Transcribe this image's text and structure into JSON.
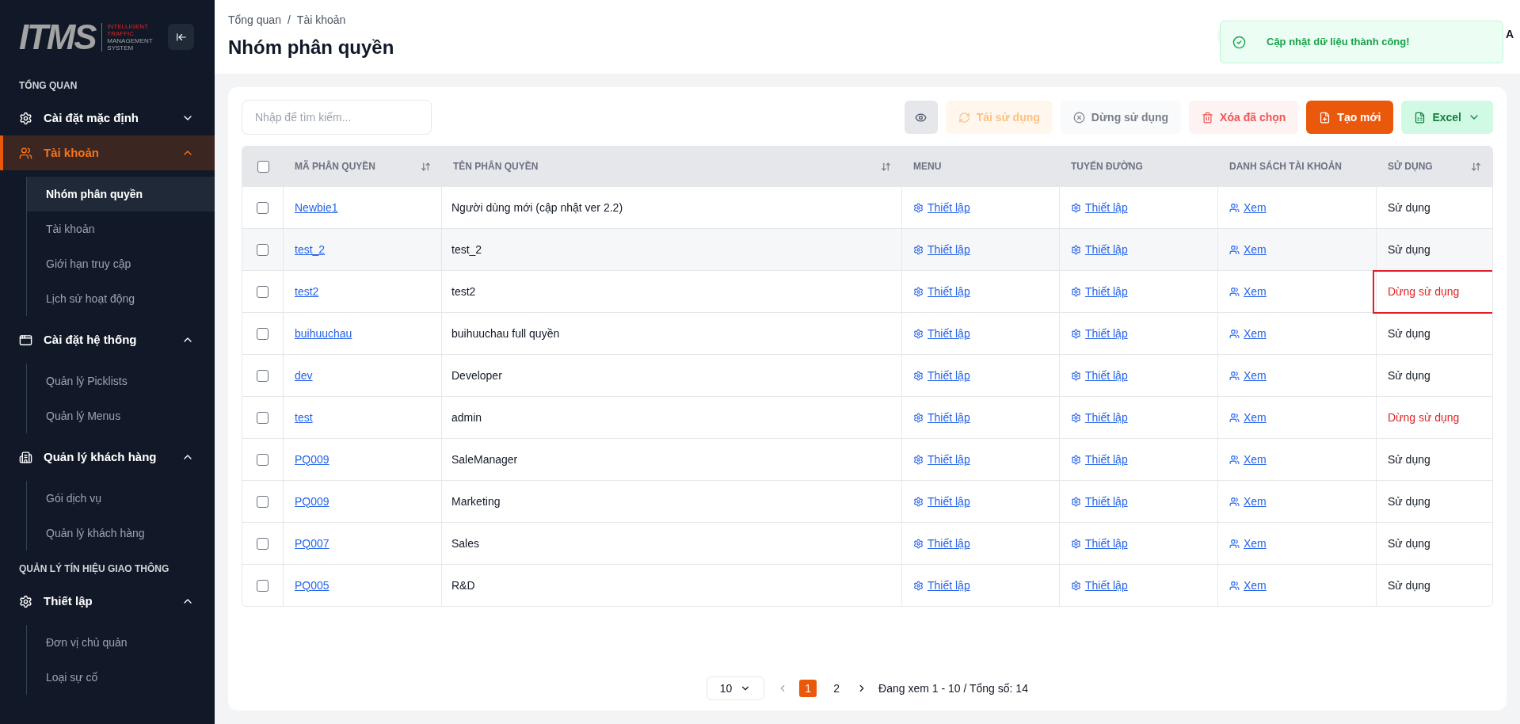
{
  "sidebar": {
    "logo": {
      "mark": "ITMS",
      "tagline_red": [
        "INTELLIGENT",
        "TRAFFIC"
      ],
      "tagline_grey": [
        "MANAGEMENT",
        "SYSTEM"
      ]
    },
    "sections": [
      {
        "heading": "TỔNG QUAN",
        "groups": [
          {
            "label": "Cài đặt mặc định",
            "expanded": false,
            "selected": false
          },
          {
            "label": "Tài khoản",
            "expanded": true,
            "selected": true,
            "children": [
              {
                "label": "Nhóm phân quyền",
                "selected": true
              },
              {
                "label": "Tài khoản",
                "selected": false
              },
              {
                "label": "Giới hạn truy cập",
                "selected": false
              },
              {
                "label": "Lịch sử hoạt động",
                "selected": false
              }
            ]
          },
          {
            "label": "Cài đặt hệ thống",
            "expanded": true,
            "selected": false,
            "children": [
              {
                "label": "Quản lý Picklists",
                "selected": false
              },
              {
                "label": "Quản lý Menus",
                "selected": false
              }
            ]
          },
          {
            "label": "Quản lý khách hàng",
            "expanded": true,
            "selected": false,
            "children": [
              {
                "label": "Gói dịch vụ",
                "selected": false
              },
              {
                "label": "Quản lý khách hàng",
                "selected": false
              }
            ]
          }
        ]
      },
      {
        "heading": "QUẢN LÝ TÍN HIỆU GIAO THÔNG",
        "groups": [
          {
            "label": "Thiết lập",
            "expanded": true,
            "selected": false,
            "children": [
              {
                "label": "Đơn vị chủ quản",
                "selected": false
              },
              {
                "label": "Loại sự cố",
                "selected": false
              }
            ]
          }
        ]
      }
    ]
  },
  "breadcrumb": {
    "items": [
      "Tổng quan",
      "Tài khoản"
    ],
    "separator": "/"
  },
  "page_title": "Nhóm phân quyền",
  "user_initial": "A",
  "toast": {
    "kind": "success",
    "message": "Cập nhật dữ liệu thành công!"
  },
  "search": {
    "placeholder": "Nhập để tìm kiếm..."
  },
  "toolbar": [
    {
      "kind": "view",
      "disabled": false
    },
    {
      "kind": "reuse",
      "label": "Tái sử dụng",
      "disabled": true
    },
    {
      "kind": "stop",
      "label": "Dừng sử dụng",
      "disabled": true
    },
    {
      "kind": "delete",
      "label": "Xóa đã chọn",
      "disabled": true
    },
    {
      "kind": "create",
      "label": "Tạo mới",
      "disabled": false
    },
    {
      "kind": "export",
      "label": "Excel",
      "disabled": false
    }
  ],
  "table": {
    "select_all": {
      "checked": false
    },
    "columns": [
      {
        "label": "MÃ PHÂN QUYỀN",
        "sortable": true
      },
      {
        "label": "TÊN PHÂN QUYỀN",
        "sortable": true
      },
      {
        "label": "MENU",
        "sortable": false
      },
      {
        "label": "TUYẾN ĐƯỜNG",
        "sortable": false
      },
      {
        "label": "DANH SÁCH TÀI KHOẢN",
        "sortable": false
      },
      {
        "label": "SỬ DỤNG",
        "sortable": true
      }
    ],
    "rows": [
      {
        "checked": false,
        "hovered": false,
        "code": "Newbie1",
        "name": "Người dùng mới (cập nhật ver 2.2)",
        "menu": "Thiết lập",
        "route": "Thiết lập",
        "accounts": "Xem",
        "status": "Sử dụng",
        "in_use": true,
        "highlighted": false
      },
      {
        "checked": false,
        "hovered": true,
        "code": "test_2",
        "name": "test_2",
        "menu": "Thiết lập",
        "route": "Thiết lập",
        "accounts": "Xem",
        "status": "Sử dụng",
        "in_use": true,
        "highlighted": false
      },
      {
        "checked": false,
        "hovered": false,
        "code": "test2",
        "name": "test2",
        "menu": "Thiết lập",
        "route": "Thiết lập",
        "accounts": "Xem",
        "status": "Dừng sử dụng",
        "in_use": false,
        "highlighted": true
      },
      {
        "checked": false,
        "hovered": false,
        "code": "buihuuchau",
        "name": "buihuuchau full quyền",
        "menu": "Thiết lập",
        "route": "Thiết lập",
        "accounts": "Xem",
        "status": "Sử dụng",
        "in_use": true,
        "highlighted": false
      },
      {
        "checked": false,
        "hovered": false,
        "code": "dev",
        "name": "Developer",
        "menu": "Thiết lập",
        "route": "Thiết lập",
        "accounts": "Xem",
        "status": "Sử dụng",
        "in_use": true,
        "highlighted": false
      },
      {
        "checked": false,
        "hovered": false,
        "code": "test",
        "name": "admin",
        "menu": "Thiết lập",
        "route": "Thiết lập",
        "accounts": "Xem",
        "status": "Dừng sử dụng",
        "in_use": false,
        "highlighted": false
      },
      {
        "checked": false,
        "hovered": false,
        "code": "PQ009",
        "name": "SaleManager",
        "menu": "Thiết lập",
        "route": "Thiết lập",
        "accounts": "Xem",
        "status": "Sử dụng",
        "in_use": true,
        "highlighted": false
      },
      {
        "checked": false,
        "hovered": false,
        "code": "PQ009",
        "name": "Marketing",
        "menu": "Thiết lập",
        "route": "Thiết lập",
        "accounts": "Xem",
        "status": "Sử dụng",
        "in_use": true,
        "highlighted": false
      },
      {
        "checked": false,
        "hovered": false,
        "code": "PQ007",
        "name": "Sales",
        "menu": "Thiết lập",
        "route": "Thiết lập",
        "accounts": "Xem",
        "status": "Sử dụng",
        "in_use": true,
        "highlighted": false
      },
      {
        "checked": false,
        "hovered": false,
        "code": "PQ005",
        "name": "R&D",
        "menu": "Thiết lập",
        "route": "Thiết lập",
        "accounts": "Xem",
        "status": "Sử dụng",
        "in_use": true,
        "highlighted": false
      }
    ]
  },
  "pagination": {
    "page_size": "10",
    "pages": [
      {
        "label": "1",
        "selected": true
      },
      {
        "label": "2",
        "selected": false
      }
    ],
    "summary": "Đang xem 1 - 10 / Tổng số: 14"
  }
}
